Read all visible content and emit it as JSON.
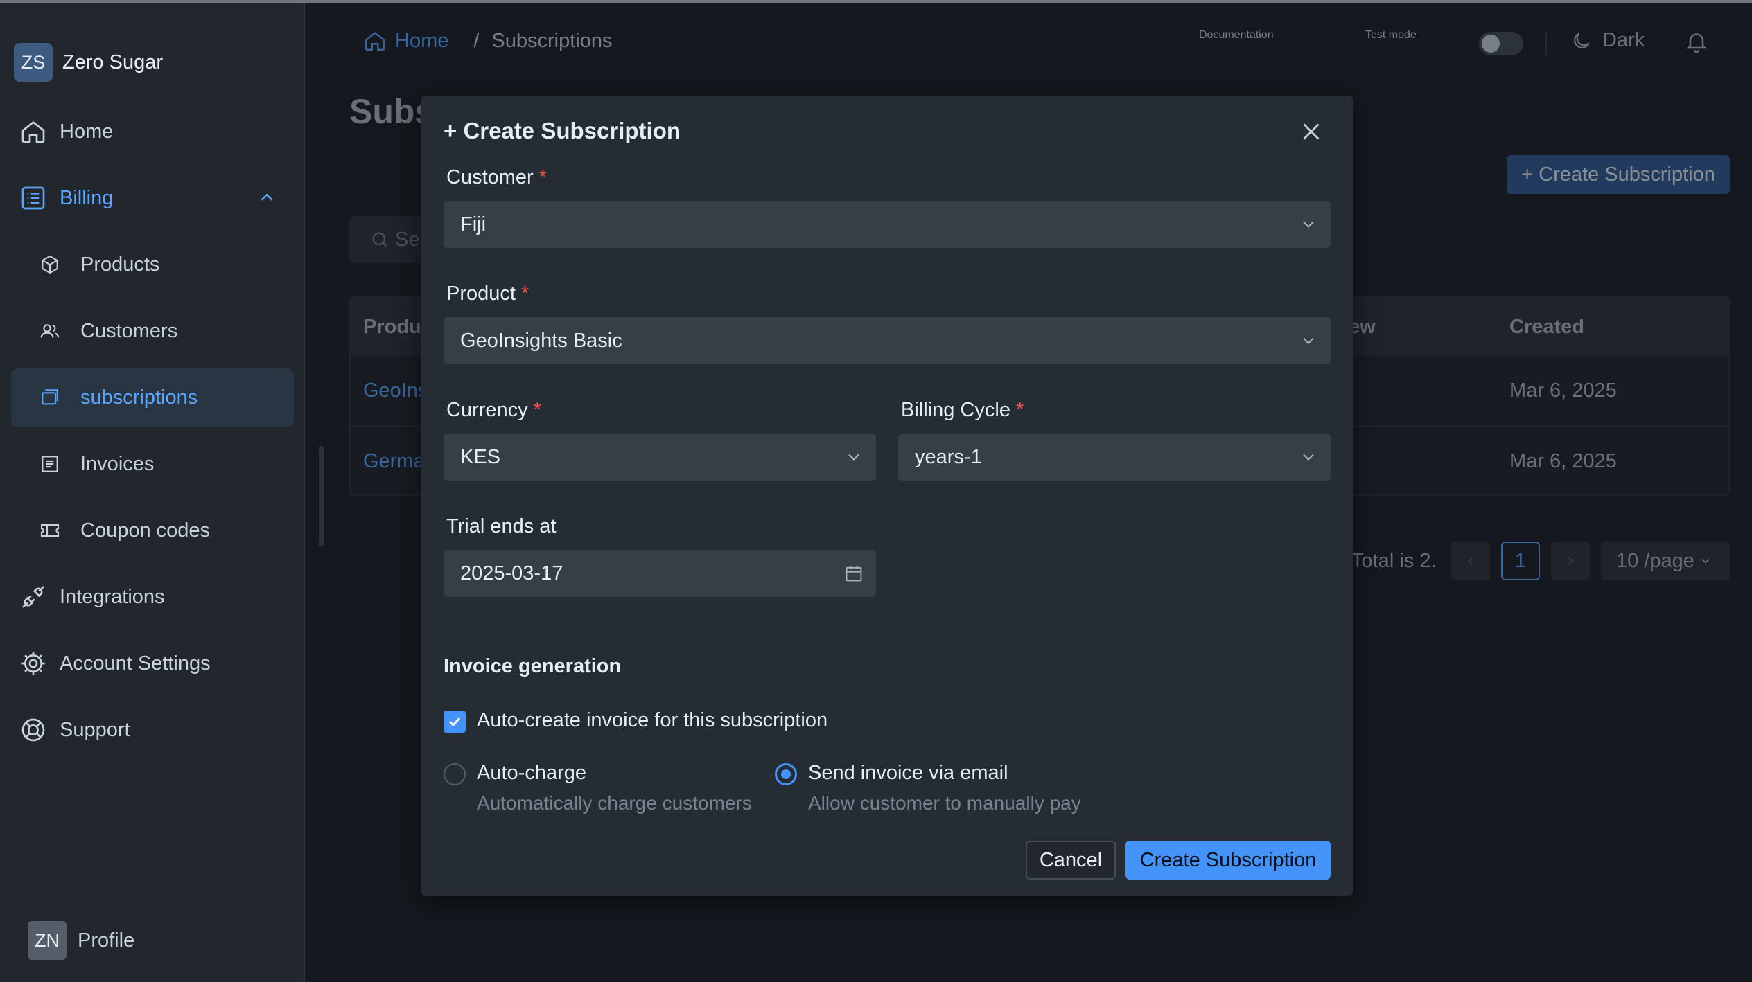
{
  "workspace": {
    "initials": "ZS",
    "name": "Zero Sugar"
  },
  "sidebar": {
    "items": [
      {
        "label": "Home",
        "icon": "home-icon"
      },
      {
        "label": "Billing",
        "icon": "list-icon"
      },
      {
        "label": "Products",
        "icon": "cube-icon"
      },
      {
        "label": "Customers",
        "icon": "users-icon"
      },
      {
        "label": "subscriptions",
        "icon": "copy-icon"
      },
      {
        "label": "Invoices",
        "icon": "receipt-icon"
      },
      {
        "label": "Coupon codes",
        "icon": "ticket-icon"
      },
      {
        "label": "Integrations",
        "icon": "plug-icon"
      },
      {
        "label": "Account Settings",
        "icon": "gear-icon"
      },
      {
        "label": "Support",
        "icon": "lifebuoy-icon"
      }
    ]
  },
  "profile": {
    "initials": "ZN",
    "label": "Profile"
  },
  "header": {
    "breadcrumb_home": "Home",
    "breadcrumb_sep": "/",
    "breadcrumb_current": "Subscriptions",
    "documentation": "Documentation",
    "test_mode": "Test mode",
    "theme": "Dark"
  },
  "page": {
    "title": "Subs",
    "create_button": "+ Create Subscription",
    "search_placeholder": "Sea",
    "table": {
      "col_product": "Produc",
      "col_renew": "ew",
      "col_created": "Created",
      "rows": [
        {
          "product": "GeoIns",
          "created": "Mar 6, 2025"
        },
        {
          "product": "Germa",
          "created": "Mar 6, 2025"
        }
      ]
    },
    "pagination": {
      "total": "Total is 2.",
      "current": "1",
      "page_size": "10 /page"
    }
  },
  "modal": {
    "title": "+ Create Subscription",
    "required_mark": "*",
    "customer_label": "Customer",
    "customer_value": "Fiji",
    "product_label": "Product",
    "product_value": "GeoInsights Basic",
    "currency_label": "Currency",
    "currency_value": "KES",
    "billing_cycle_label": "Billing Cycle",
    "billing_cycle_value": "years-1",
    "trial_label": "Trial ends at",
    "trial_value": "2025-03-17",
    "invoice_section": "Invoice generation",
    "auto_create_label": "Auto-create invoice for this subscription",
    "auto_create_checked": true,
    "option_autocharge_label": "Auto-charge",
    "option_autocharge_desc": "Automatically charge customers",
    "option_email_label": "Send invoice via email",
    "option_email_desc": "Allow customer to manually pay",
    "selected_option": "Send invoice via email",
    "cancel_label": "Cancel",
    "submit_label": "Create Subscription"
  },
  "colors": {
    "accent": "#4393f8",
    "link": "#58a6ff",
    "required": "#f85149",
    "background": "#1c2128"
  }
}
